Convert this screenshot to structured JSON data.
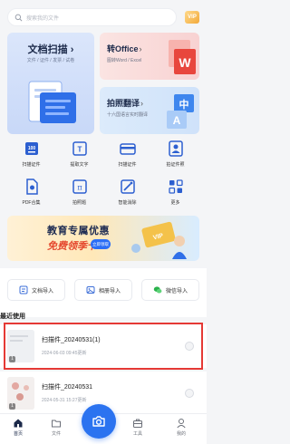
{
  "search": {
    "placeholder": "搜索我的文件"
  },
  "vip_badge": "VIP",
  "cards": {
    "scan": {
      "title": "文档扫描",
      "chevron": "›",
      "subtitle": "文件 / 证件 / 发票 / 试卷"
    },
    "office": {
      "title": "转Office",
      "chevron": "›",
      "subtitle": "图转Word / Excel"
    },
    "translate": {
      "title": "拍照翻译",
      "chevron": "›",
      "subtitle": "十六国语言实时翻译"
    }
  },
  "tools": [
    {
      "label": "扫描证件",
      "icon": "id-scan-icon",
      "color": "#3b6fd8"
    },
    {
      "label": "提取文字",
      "icon": "text-extract-icon",
      "color": "#3b6fd8"
    },
    {
      "label": "扫描证件",
      "icon": "card-scan-icon",
      "color": "#3b6fd8"
    },
    {
      "label": "拍证件照",
      "icon": "id-photo-icon",
      "color": "#3b6fd8"
    },
    {
      "label": "PDF合集",
      "icon": "pdf-icon",
      "color": "#3b6fd8"
    },
    {
      "label": "拍照题",
      "icon": "formula-icon",
      "color": "#3b6fd8"
    },
    {
      "label": "智能消除",
      "icon": "magic-erase-icon",
      "color": "#3b6fd8"
    },
    {
      "label": "更多",
      "icon": "more-grid-icon",
      "color": "#3b6fd8"
    }
  ],
  "promo": {
    "line1": "教育专属优惠",
    "line2": "免费领季卡",
    "button": "立即领取"
  },
  "imports": [
    {
      "label": "文档导入",
      "icon": "doc-import-icon"
    },
    {
      "label": "相册导入",
      "icon": "album-import-icon"
    },
    {
      "label": "微信导入",
      "icon": "wechat-import-icon"
    }
  ],
  "recent": {
    "title": "最近使用",
    "items": [
      {
        "name": "扫描件_20240531(1)",
        "meta": "2024-06-03 09:45更新",
        "count": "1"
      },
      {
        "name": "扫描件_20240531",
        "meta": "2024-05-31 15:27更新",
        "count": "1"
      }
    ]
  },
  "nav": {
    "home": "首页",
    "files": "文件",
    "tools": "工具",
    "mine": "我的"
  },
  "colors": {
    "accent": "#2b73f0",
    "highlight": "#e53935"
  }
}
